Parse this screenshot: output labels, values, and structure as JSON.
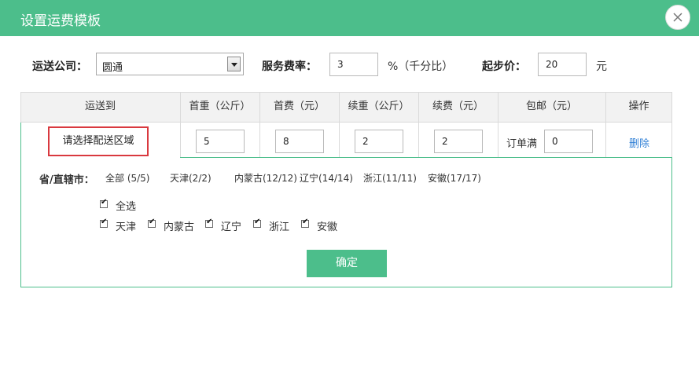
{
  "dialog": {
    "title": "设置运费模板"
  },
  "form": {
    "company_label": "运送公司：",
    "company_value": "圆通",
    "fee_rate_label": "服务费率：",
    "fee_rate_value": "3",
    "fee_rate_unit": "%（千分比）",
    "start_price_label": "起步价：",
    "start_price_value": "20",
    "start_price_unit": "元"
  },
  "table": {
    "headers": [
      "运送到",
      "首重（公斤）",
      "首费（元）",
      "续重（公斤）",
      "续费（元）",
      "包邮（元）",
      "操作"
    ],
    "row": {
      "region_button": "请选择配送区域",
      "first_weight": "5",
      "first_fee": "8",
      "extra_weight": "2",
      "extra_fee": "2",
      "free_label": "订单满",
      "free_value": "0",
      "delete": "删除"
    }
  },
  "region_panel": {
    "title": "省/直辖市：",
    "provinces": [
      "全部 (5/5)",
      "天津(2/2)",
      "内蒙古(12/12)",
      "辽宁(14/14)",
      "浙江(11/11)",
      "安徽(17/17)"
    ],
    "select_all": "全选",
    "checks": [
      "天津",
      "内蒙古",
      "辽宁",
      "浙江",
      "安徽"
    ],
    "confirm": "确定"
  }
}
